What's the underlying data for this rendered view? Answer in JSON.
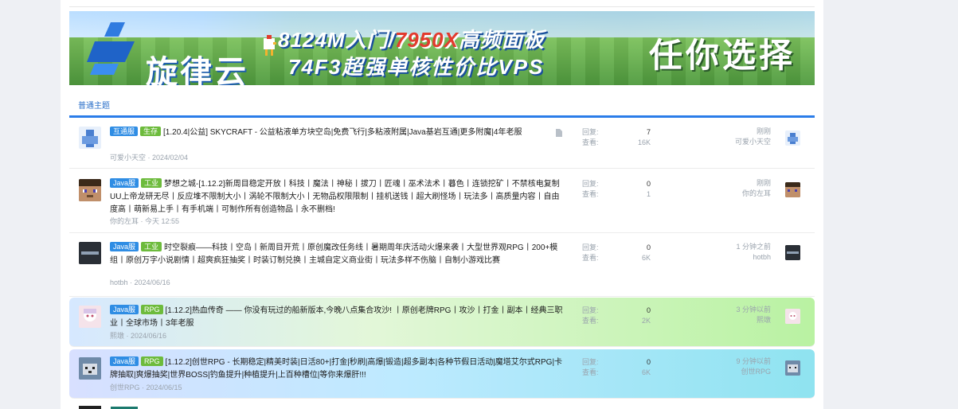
{
  "banner": {
    "logo": "旋律云",
    "line1_part1": "8124M入门/",
    "line1_red": "7950X",
    "line1_part2": "高频面板",
    "line2": "74F3超强单核性价比VPS",
    "slogan": "任你选择"
  },
  "section": {
    "title": "普通主题"
  },
  "labels": {
    "replies": "回复:",
    "views": "查看:"
  },
  "threads": [
    {
      "tags": [
        "互通服",
        "生存"
      ],
      "title": "[1.20.4|公益] SKYCRAFT - 公益粘液单方块空岛|免费飞行|多粘液附属|Java基岩互通|更多附魔|4年老服",
      "author": "可爱小天空",
      "date": "2024/02/04",
      "replies": "7",
      "views": "16K",
      "last_time": "刚刚",
      "last_user": "可爱小天空"
    },
    {
      "tags": [
        "Java服",
        "工业"
      ],
      "title": "梦想之城-[1.12.2]新周目稳定开放丨科技丨魔法丨神秘丨拔刀丨匠魂丨巫术法术丨暮色丨连锁挖矿丨不禁核电复制UU上帝龙研无尽丨反应堆不限制大小丨涡轮不限制大小丨无物品权限限制丨挂机送钱丨超大刷怪场丨玩法多丨高质量内容丨自由度高丨萌新易上手丨有手机端丨可制作所有创造物品丨永不删档!",
      "author": "你的左耳",
      "date": "今天 12:55",
      "replies": "0",
      "views": "1",
      "last_time": "刚刚",
      "last_user": "你的左耳"
    },
    {
      "tags": [
        "Java服",
        "工业"
      ],
      "title": "时空裂痕——科技丨空岛丨新周目开荒丨原创魔改任务线丨暑期周年庆活动火爆来袭丨大型世界观RPG丨200+模组丨原创万字小说剧情丨超爽疯狂抽奖丨时装订制兑换丨主城自定义商业街丨玩法多样不伤脑丨自制小游戏比赛",
      "author": "hotbh",
      "date": "2024/06/16",
      "replies": "0",
      "views": "6K",
      "last_time": "1 分钟之前",
      "last_user": "hotbh"
    },
    {
      "tags": [
        "Java服",
        "RPG"
      ],
      "title": "[1.12.2]热血传奇 —— 你没有玩过的船新版本,今晚八点集合攻沙! 丨原创老牌RPG丨攻沙丨打金丨副本丨经典三职业丨全球市场丨3年老服",
      "author": "熙墩",
      "date": "2024/06/16",
      "replies": "0",
      "views": "2K",
      "last_time": "3 分钟以前",
      "last_user": "熙墩"
    },
    {
      "tags": [
        "Java服",
        "RPG"
      ],
      "title": "[1.12.2]创世RPG - 长期稳定|精美时装|日活80+|打金|秒刷|高爆|锻造|超多副本|各种节假日活动|魔塔艾尔式RPG|卡牌抽取|爽爆抽奖|世界BOSS|钓鱼提升|种植提升|上百种槽位|等你来爆肝!!!",
      "author": "创世RPG",
      "date": "2024/06/15",
      "replies": "0",
      "views": "6K",
      "last_time": "9 分钟以前",
      "last_user": "创世RPG"
    }
  ]
}
